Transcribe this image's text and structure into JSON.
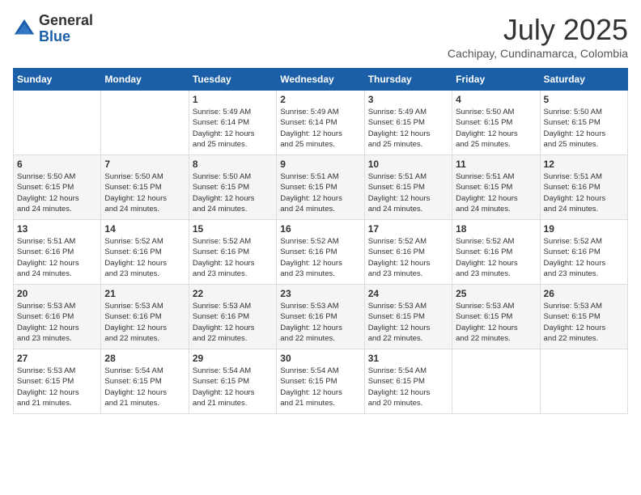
{
  "header": {
    "logo_general": "General",
    "logo_blue": "Blue",
    "month": "July 2025",
    "location": "Cachipay, Cundinamarca, Colombia"
  },
  "weekdays": [
    "Sunday",
    "Monday",
    "Tuesday",
    "Wednesday",
    "Thursday",
    "Friday",
    "Saturday"
  ],
  "weeks": [
    [
      {
        "day": "",
        "info": ""
      },
      {
        "day": "",
        "info": ""
      },
      {
        "day": "1",
        "info": "Sunrise: 5:49 AM\nSunset: 6:14 PM\nDaylight: 12 hours\nand 25 minutes."
      },
      {
        "day": "2",
        "info": "Sunrise: 5:49 AM\nSunset: 6:14 PM\nDaylight: 12 hours\nand 25 minutes."
      },
      {
        "day": "3",
        "info": "Sunrise: 5:49 AM\nSunset: 6:15 PM\nDaylight: 12 hours\nand 25 minutes."
      },
      {
        "day": "4",
        "info": "Sunrise: 5:50 AM\nSunset: 6:15 PM\nDaylight: 12 hours\nand 25 minutes."
      },
      {
        "day": "5",
        "info": "Sunrise: 5:50 AM\nSunset: 6:15 PM\nDaylight: 12 hours\nand 25 minutes."
      }
    ],
    [
      {
        "day": "6",
        "info": "Sunrise: 5:50 AM\nSunset: 6:15 PM\nDaylight: 12 hours\nand 24 minutes."
      },
      {
        "day": "7",
        "info": "Sunrise: 5:50 AM\nSunset: 6:15 PM\nDaylight: 12 hours\nand 24 minutes."
      },
      {
        "day": "8",
        "info": "Sunrise: 5:50 AM\nSunset: 6:15 PM\nDaylight: 12 hours\nand 24 minutes."
      },
      {
        "day": "9",
        "info": "Sunrise: 5:51 AM\nSunset: 6:15 PM\nDaylight: 12 hours\nand 24 minutes."
      },
      {
        "day": "10",
        "info": "Sunrise: 5:51 AM\nSunset: 6:15 PM\nDaylight: 12 hours\nand 24 minutes."
      },
      {
        "day": "11",
        "info": "Sunrise: 5:51 AM\nSunset: 6:15 PM\nDaylight: 12 hours\nand 24 minutes."
      },
      {
        "day": "12",
        "info": "Sunrise: 5:51 AM\nSunset: 6:16 PM\nDaylight: 12 hours\nand 24 minutes."
      }
    ],
    [
      {
        "day": "13",
        "info": "Sunrise: 5:51 AM\nSunset: 6:16 PM\nDaylight: 12 hours\nand 24 minutes."
      },
      {
        "day": "14",
        "info": "Sunrise: 5:52 AM\nSunset: 6:16 PM\nDaylight: 12 hours\nand 23 minutes."
      },
      {
        "day": "15",
        "info": "Sunrise: 5:52 AM\nSunset: 6:16 PM\nDaylight: 12 hours\nand 23 minutes."
      },
      {
        "day": "16",
        "info": "Sunrise: 5:52 AM\nSunset: 6:16 PM\nDaylight: 12 hours\nand 23 minutes."
      },
      {
        "day": "17",
        "info": "Sunrise: 5:52 AM\nSunset: 6:16 PM\nDaylight: 12 hours\nand 23 minutes."
      },
      {
        "day": "18",
        "info": "Sunrise: 5:52 AM\nSunset: 6:16 PM\nDaylight: 12 hours\nand 23 minutes."
      },
      {
        "day": "19",
        "info": "Sunrise: 5:52 AM\nSunset: 6:16 PM\nDaylight: 12 hours\nand 23 minutes."
      }
    ],
    [
      {
        "day": "20",
        "info": "Sunrise: 5:53 AM\nSunset: 6:16 PM\nDaylight: 12 hours\nand 23 minutes."
      },
      {
        "day": "21",
        "info": "Sunrise: 5:53 AM\nSunset: 6:16 PM\nDaylight: 12 hours\nand 22 minutes."
      },
      {
        "day": "22",
        "info": "Sunrise: 5:53 AM\nSunset: 6:16 PM\nDaylight: 12 hours\nand 22 minutes."
      },
      {
        "day": "23",
        "info": "Sunrise: 5:53 AM\nSunset: 6:16 PM\nDaylight: 12 hours\nand 22 minutes."
      },
      {
        "day": "24",
        "info": "Sunrise: 5:53 AM\nSunset: 6:15 PM\nDaylight: 12 hours\nand 22 minutes."
      },
      {
        "day": "25",
        "info": "Sunrise: 5:53 AM\nSunset: 6:15 PM\nDaylight: 12 hours\nand 22 minutes."
      },
      {
        "day": "26",
        "info": "Sunrise: 5:53 AM\nSunset: 6:15 PM\nDaylight: 12 hours\nand 22 minutes."
      }
    ],
    [
      {
        "day": "27",
        "info": "Sunrise: 5:53 AM\nSunset: 6:15 PM\nDaylight: 12 hours\nand 21 minutes."
      },
      {
        "day": "28",
        "info": "Sunrise: 5:54 AM\nSunset: 6:15 PM\nDaylight: 12 hours\nand 21 minutes."
      },
      {
        "day": "29",
        "info": "Sunrise: 5:54 AM\nSunset: 6:15 PM\nDaylight: 12 hours\nand 21 minutes."
      },
      {
        "day": "30",
        "info": "Sunrise: 5:54 AM\nSunset: 6:15 PM\nDaylight: 12 hours\nand 21 minutes."
      },
      {
        "day": "31",
        "info": "Sunrise: 5:54 AM\nSunset: 6:15 PM\nDaylight: 12 hours\nand 20 minutes."
      },
      {
        "day": "",
        "info": ""
      },
      {
        "day": "",
        "info": ""
      }
    ]
  ]
}
